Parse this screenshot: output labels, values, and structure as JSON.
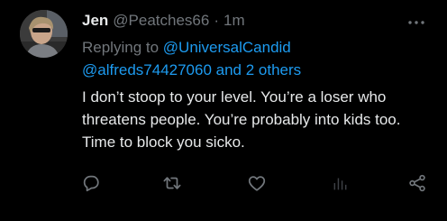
{
  "tweet": {
    "author_name": "Jen",
    "author_handle": "@Peatches66",
    "separator": "·",
    "timestamp": "1m",
    "reply_prefix": "Replying to ",
    "reply_mentions": [
      "@UniversalCandid",
      "@alfreds74427060 and 2 others"
    ],
    "text": "I don’t stoop to your level. You’re a loser who threatens people. You’re probably into kids too. Time to block you sicko."
  },
  "icons": {
    "more": "more-horizontal-icon",
    "reply": "reply-icon",
    "retweet": "retweet-icon",
    "like": "like-icon",
    "views": "views-icon",
    "share": "share-icon"
  },
  "colors": {
    "background": "#000000",
    "text_primary": "#e7e9ea",
    "text_secondary": "#71767b",
    "accent": "#1d9bf0"
  }
}
